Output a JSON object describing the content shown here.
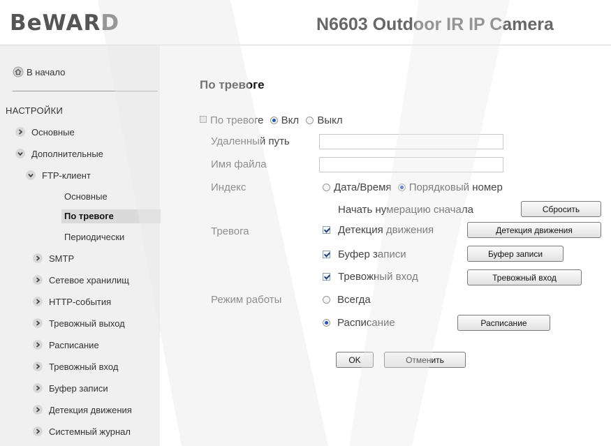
{
  "header": {
    "logo": "BeWARD",
    "product": "N6603 Outdoor IR IP Camera"
  },
  "sidebar": {
    "home": "В начало",
    "section_title": "НАСТРОЙКИ",
    "items": [
      {
        "label": "Основные",
        "state": "collapsed"
      },
      {
        "label": "Дополнительные",
        "state": "expanded"
      },
      {
        "label": "FTP-клиент",
        "state": "expanded"
      },
      {
        "label": "SMTP",
        "state": "collapsed"
      },
      {
        "label": "Сетевое хранилищ",
        "state": "collapsed"
      },
      {
        "label": "HTTP-события",
        "state": "collapsed"
      },
      {
        "label": "Тревожный выход",
        "state": "collapsed"
      },
      {
        "label": "Расписание",
        "state": "collapsed"
      },
      {
        "label": "Тревожный вход",
        "state": "collapsed"
      },
      {
        "label": "Буфер записи",
        "state": "collapsed"
      },
      {
        "label": "Детекция движения",
        "state": "collapsed"
      },
      {
        "label": "Системный журнал",
        "state": "collapsed"
      }
    ],
    "ftp_sub": [
      {
        "label": "Основные",
        "active": false
      },
      {
        "label": "По тревоге",
        "active": true
      },
      {
        "label": "Периодически",
        "active": false
      }
    ]
  },
  "main": {
    "title": "По тревоге",
    "alarm_label": "По тревоге",
    "alarm_on": "Вкл",
    "alarm_off": "Выкл",
    "alarm_value": "on",
    "remote_path_label": "Удаленный путь",
    "remote_path_value": "",
    "filename_label": "Имя файла",
    "filename_value": "",
    "index_label": "Индекс",
    "index_datetime": "Дата/Время",
    "index_sequence": "Порядковый номер",
    "index_value": "sequence",
    "restart_numbering_label": "Начать нумерацию сначала",
    "reset_button": "Сбросить",
    "trigger_label": "Тревога",
    "trigger_motion": "Детекция движения",
    "trigger_motion_button": "Детекция движения",
    "trigger_buffer": "Буфер записи",
    "trigger_buffer_button": "Буфер записи",
    "trigger_input": "Тревожный вход",
    "trigger_input_button": "Тревожный вход",
    "mode_label": "Режим работы",
    "mode_always": "Всегда",
    "mode_schedule": "Расписание",
    "mode_value": "schedule",
    "schedule_button": "Расписание",
    "ok_button": "OK",
    "cancel_button": "Отменить"
  }
}
